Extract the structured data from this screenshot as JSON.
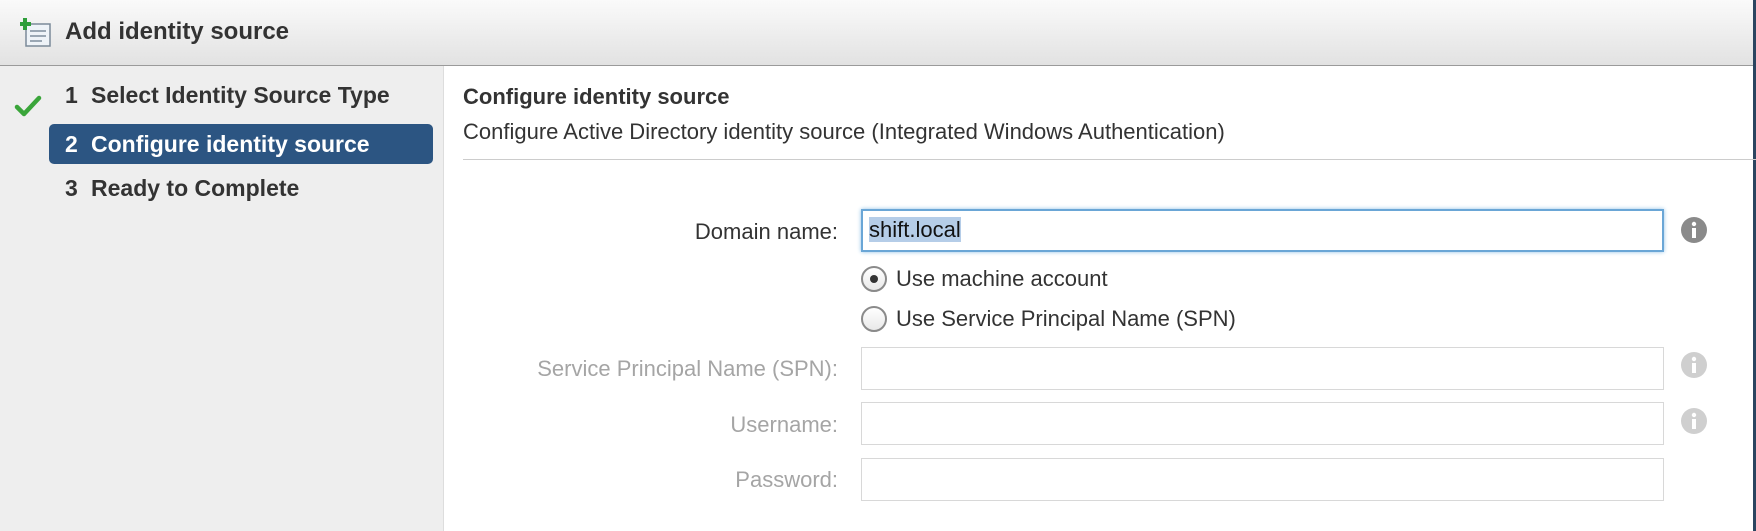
{
  "dialog": {
    "title": "Add identity source",
    "icon": "add-identity-source-icon"
  },
  "nav": {
    "steps": [
      {
        "number": "1",
        "label": "Select Identity Source Type",
        "state": "completed",
        "icon": "checkmark-icon"
      },
      {
        "number": "2",
        "label": "Configure identity source",
        "state": "active"
      },
      {
        "number": "3",
        "label": "Ready to Complete",
        "state": "pending"
      }
    ]
  },
  "main": {
    "title": "Configure identity source",
    "subtitle": "Configure Active Directory identity source (Integrated Windows Authentication)",
    "form": {
      "domain_name": {
        "label": "Domain name:",
        "value": "shift.local",
        "selected": true
      },
      "auth_options": [
        {
          "label": "Use machine account",
          "checked": true
        },
        {
          "label": "Use Service Principal Name (SPN)",
          "checked": false
        }
      ],
      "spn": {
        "label": "Service Principal Name (SPN):",
        "value": "",
        "disabled": true
      },
      "username": {
        "label": "Username:",
        "value": "",
        "disabled": true
      },
      "password": {
        "label": "Password:",
        "value": "",
        "disabled": true
      }
    }
  },
  "colors": {
    "active_step_bg": "#2c5582",
    "check_green": "#3aa53a",
    "focus_border": "#6aa6d6",
    "selection_bg": "#b5cde8",
    "disabled_text": "#a5a5a5",
    "info_icon": "#8a8a8a"
  }
}
